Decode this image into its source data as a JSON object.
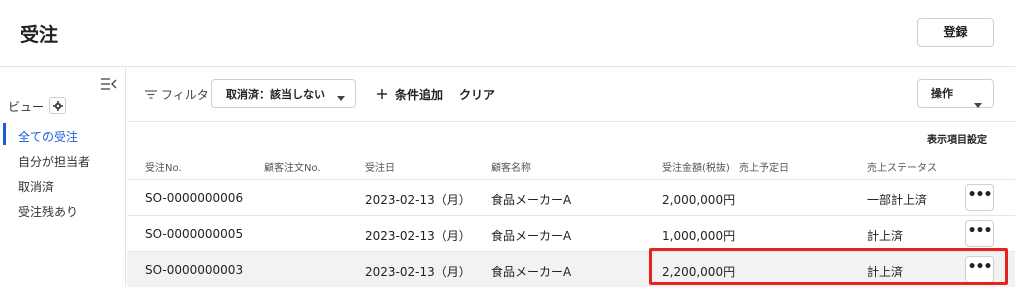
{
  "header": {
    "title": "受注",
    "register_label": "登録"
  },
  "sidebar": {
    "view_label": "ビュー",
    "items": [
      {
        "label": "全ての受注",
        "active": true
      },
      {
        "label": "自分が担当者",
        "active": false
      },
      {
        "label": "取消済",
        "active": false
      },
      {
        "label": "受注残あり",
        "active": false
      }
    ]
  },
  "filter": {
    "label": "フィルタ",
    "chip_label": "取消済：該当しない",
    "add_condition_label": "条件追加",
    "clear_label": "クリア",
    "operations_label": "操作"
  },
  "table": {
    "display_settings_label": "表示項目設定",
    "columns": [
      "受注No.",
      "顧客注文No.",
      "受注日",
      "顧客名称",
      "受注金額(税抜)",
      "売上予定日",
      "売上ステータス"
    ],
    "rows": [
      {
        "order_no": "SO-0000000006",
        "customer_order_no": "",
        "order_date": "2023-02-13（月）",
        "customer": "食品メーカーA",
        "amount": "2,000,000円",
        "sales_date": "",
        "status": "一部計上済",
        "more": "•••"
      },
      {
        "order_no": "SO-0000000005",
        "customer_order_no": "",
        "order_date": "2023-02-13（月）",
        "customer": "食品メーカーA",
        "amount": "1,000,000円",
        "sales_date": "",
        "status": "計上済",
        "more": "•••"
      },
      {
        "order_no": "SO-0000000003",
        "customer_order_no": "",
        "order_date": "2023-02-13（月）",
        "customer": "食品メーカーA",
        "amount": "2,200,000円",
        "sales_date": "",
        "status": "計上済",
        "more": "•••"
      }
    ]
  },
  "colors": {
    "accent": "#1a5fd6",
    "highlight": "#e8231b",
    "row_shaded": "#f2f2f2"
  }
}
